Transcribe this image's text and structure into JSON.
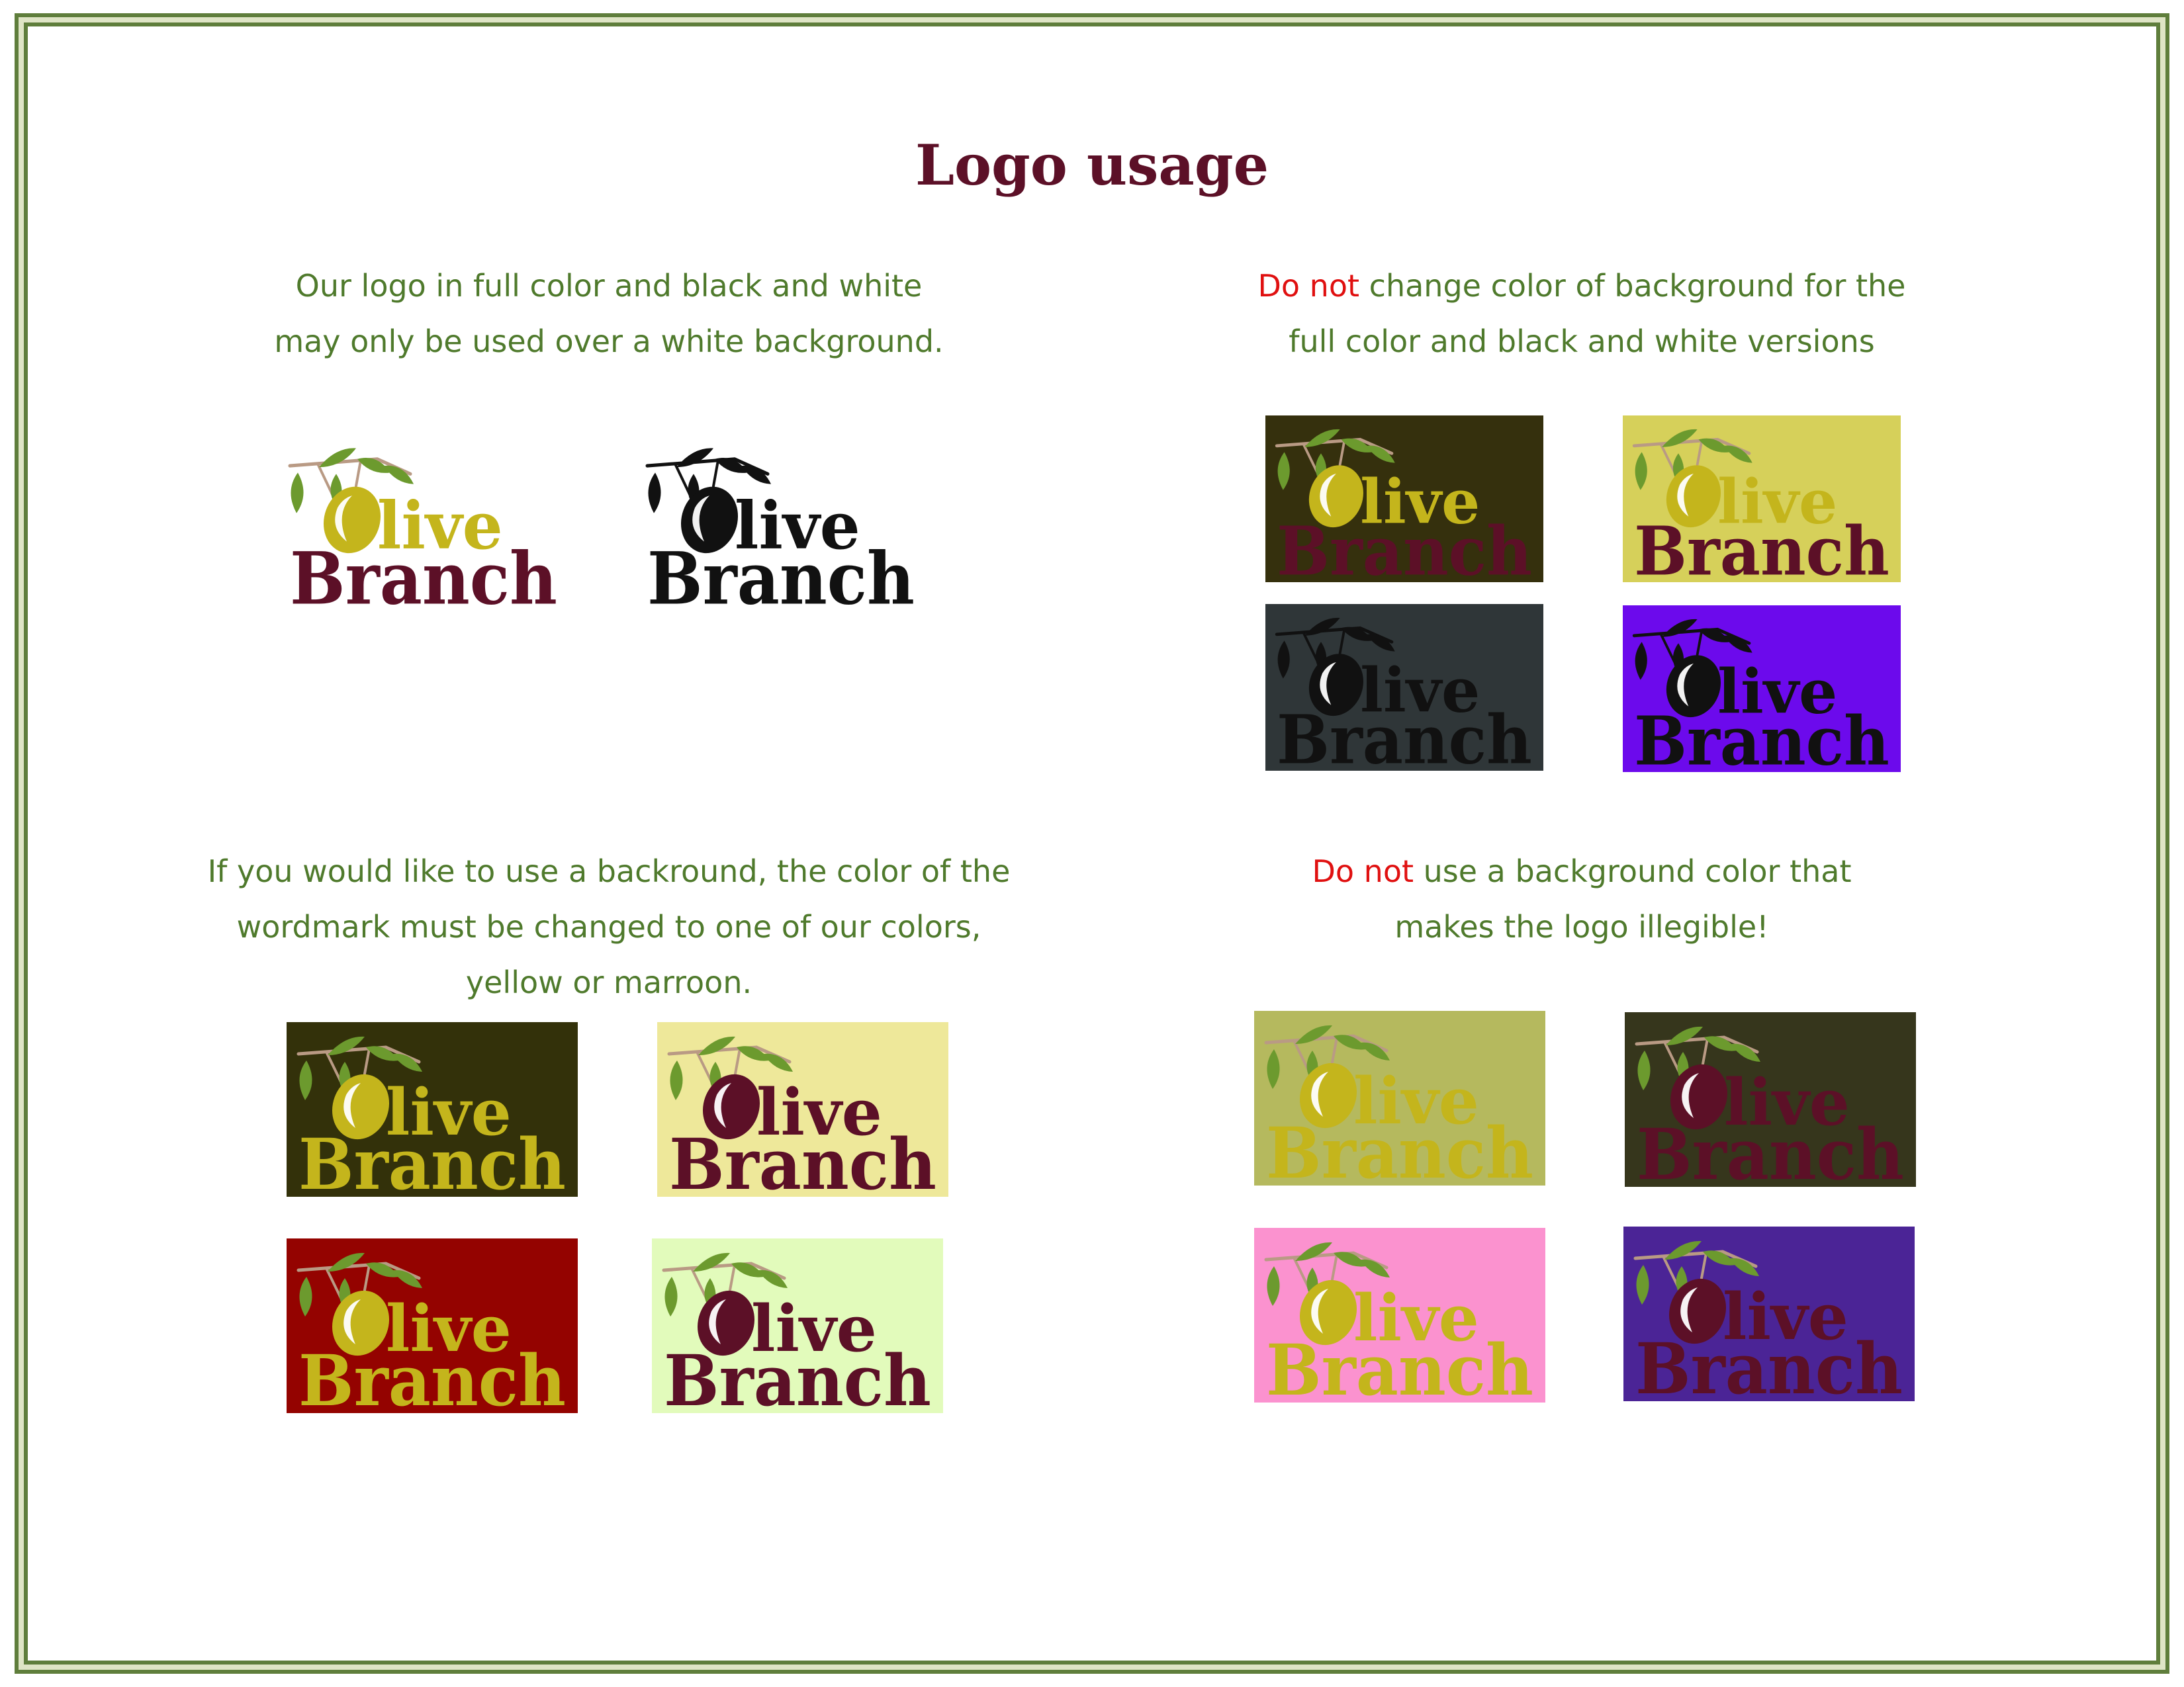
{
  "page": {
    "title": "Logo usage"
  },
  "brand": {
    "word1": "Olive",
    "word1_rest": "live",
    "word2": "Branch"
  },
  "sections": {
    "top_left": {
      "line1": "Our logo in full color and black and white",
      "line2": "may only be used over a white background."
    },
    "top_right": {
      "warn": "Do not",
      "line1_rest": " change color of background for the",
      "line2": "full color and black and white versions"
    },
    "bottom_left": {
      "line1": "If you would like to use a backround, the color of the",
      "line2": "wordmark must be changed to one of our colors,",
      "line3": "yellow or marroon."
    },
    "bottom_right": {
      "warn": "Do not",
      "line1_rest": " use a background color that",
      "line2": "makes the logo illegible!"
    }
  },
  "colors": {
    "frame_green": "#5f7e3c",
    "caption_green": "#4f7a2c",
    "title_maroon": "#5c1027",
    "warning_red": "#e01010",
    "brand_yellow": "#c4b51c",
    "brand_maroon": "#5c1027",
    "leaf_green": "#6c9a2e"
  },
  "logos": [
    {
      "id": "full-color-on-white",
      "bg": "#ffffff",
      "olive": "#c4b51c",
      "word1": "#c4b51c",
      "word2": "#5c1027",
      "leaves": "#6c9a2e"
    },
    {
      "id": "black-and-white-on-white",
      "bg": "#ffffff",
      "olive": "#111111",
      "word1": "#111111",
      "word2": "#111111",
      "leaves": "#111111"
    },
    {
      "id": "bad-dark-olive-bg",
      "bg": "#35300d",
      "olive": "#c4b51c",
      "word1": "#c4b51c",
      "word2": "#5c1027",
      "leaves": "#6c9a2e"
    },
    {
      "id": "bad-yellow-bg",
      "bg": "#d6d05a",
      "olive": "#c4b51c",
      "word1": "#c4b51c",
      "word2": "#5c1027",
      "leaves": "#6c9a2e"
    },
    {
      "id": "bad-gray-bg",
      "bg": "#2f3638",
      "olive": "#111111",
      "word1": "#111111",
      "word2": "#111111",
      "leaves": "#111111"
    },
    {
      "id": "bad-violet-bg",
      "bg": "#6c0aec",
      "olive": "#111111",
      "word1": "#111111",
      "word2": "#111111",
      "leaves": "#111111"
    },
    {
      "id": "ok-dark-olive-bg",
      "bg": "#33310a",
      "olive": "#c4b51c",
      "word1": "#c4b51c",
      "word2": "#c4b51c",
      "leaves": "#6c9a2e"
    },
    {
      "id": "ok-light-yellow-bg",
      "bg": "#eee89a",
      "olive": "#5c1027",
      "word1": "#5c1027",
      "word2": "#5c1027",
      "leaves": "#6c9a2e"
    },
    {
      "id": "ok-red-bg",
      "bg": "#940300",
      "olive": "#c4b51c",
      "word1": "#c4b51c",
      "word2": "#c4b51c",
      "leaves": "#6c9a2e"
    },
    {
      "id": "ok-pale-green-bg",
      "bg": "#e2fbbb",
      "olive": "#5c1027",
      "word1": "#5c1027",
      "word2": "#5c1027",
      "leaves": "#6c9a2e"
    },
    {
      "id": "illegible-khaki-bg",
      "bg": "#b5b95e",
      "olive": "#c4b51c",
      "word1": "#c4b51c",
      "word2": "#c4b51c",
      "leaves": "#6c9a2e"
    },
    {
      "id": "illegible-dark-bg",
      "bg": "#36361c",
      "olive": "#5c1027",
      "word1": "#5c1027",
      "word2": "#5c1027",
      "leaves": "#6c9a2e"
    },
    {
      "id": "illegible-pink-bg",
      "bg": "#fb92cf",
      "olive": "#c4b51c",
      "word1": "#c4b51c",
      "word2": "#c4b51c",
      "leaves": "#6c9a2e"
    },
    {
      "id": "illegible-purple-bg",
      "bg": "#4b2496",
      "olive": "#5c1027",
      "word1": "#5c1027",
      "word2": "#5c1027",
      "leaves": "#6c9a2e"
    }
  ]
}
